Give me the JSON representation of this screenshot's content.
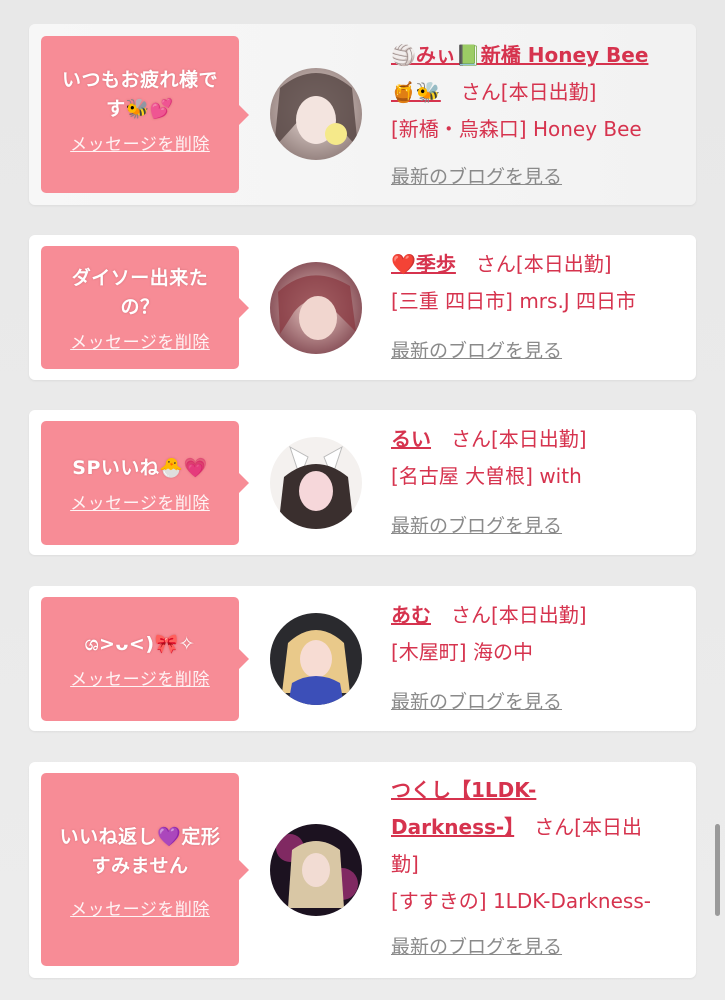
{
  "cards": [
    {
      "message_lines": [
        "いつもお疲れ様で",
        "す🐝💕"
      ],
      "delete_label": "メッセージを削除",
      "name": "🏐みぃ📗新橋 Honey Bee",
      "name_suffix": "🍯🐝",
      "san": "さん[本日出勤]",
      "location": "[新橋・烏森口] Honey Bee",
      "blog_link": "最新のブログを見る"
    },
    {
      "message_lines": [
        "ダイソー出来た",
        "の？"
      ],
      "delete_label": "メッセージを削除",
      "name": "❤️季歩",
      "san": "さん[本日出勤]",
      "location": "[三重 四日市] mrs.J 四日市",
      "blog_link": "最新のブログを見る"
    },
    {
      "message_lines": [
        "SPいいね🐣💗"
      ],
      "delete_label": "メッセージを削除",
      "name": "るい",
      "san": "さん[本日出勤]",
      "location": "[名古屋 大曽根] with",
      "blog_link": "最新のブログを見る"
    },
    {
      "message_lines": [
        "ශ>ᴗ<)🎀✧"
      ],
      "delete_label": "メッセージを削除",
      "name": "あむ",
      "san": "さん[本日出勤]",
      "location": "[木屋町] 海の中",
      "blog_link": "最新のブログを見る"
    },
    {
      "message_lines": [
        "いいね返し💜定形",
        "すみません"
      ],
      "delete_label": "メッセージを削除",
      "name_lines": [
        "つくし【1LDK-",
        "Darkness-】"
      ],
      "san_lines": [
        "さん[本日出",
        "勤]"
      ],
      "location": "[すすきの] 1LDK-Darkness-",
      "blog_link": "最新のブログを見る"
    }
  ],
  "colors": {
    "accent": "#f78c96",
    "name_red": "#d6334e",
    "link_gray": "#8a8a8a"
  },
  "icons": [
    "avatar-photo",
    "chevron-pointer"
  ]
}
